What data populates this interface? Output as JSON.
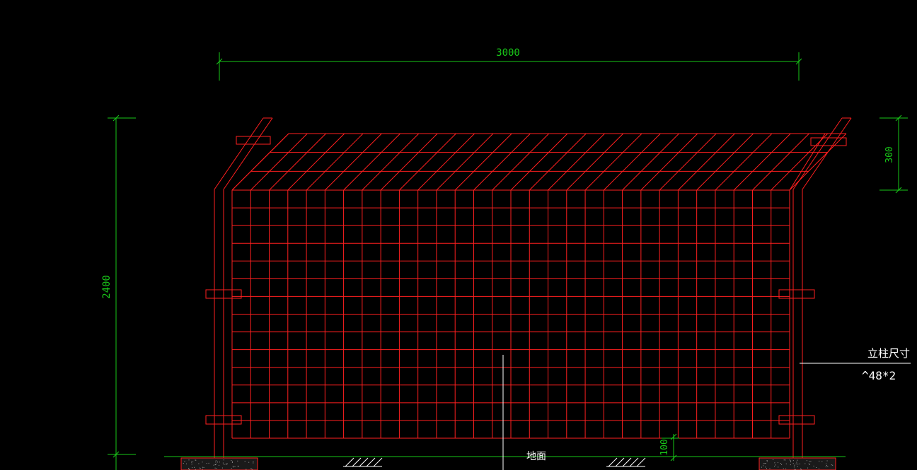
{
  "drawing": {
    "dimensions": {
      "width_label": "3000",
      "height_label": "2400",
      "top_bend_label": "300",
      "ground_gap_label": "100"
    },
    "annotations": {
      "post_size_title": "立柱尺寸",
      "post_size_value": "^48*2",
      "ground_label": "地面"
    },
    "colors": {
      "background": "#000000",
      "fence": "#ff1f1f",
      "dimension": "#19c819",
      "annotation": "#ffffff"
    },
    "mesh": {
      "vertical_wires": 31,
      "horizontal_wires": 14,
      "top_slanted_wires": 4
    }
  }
}
